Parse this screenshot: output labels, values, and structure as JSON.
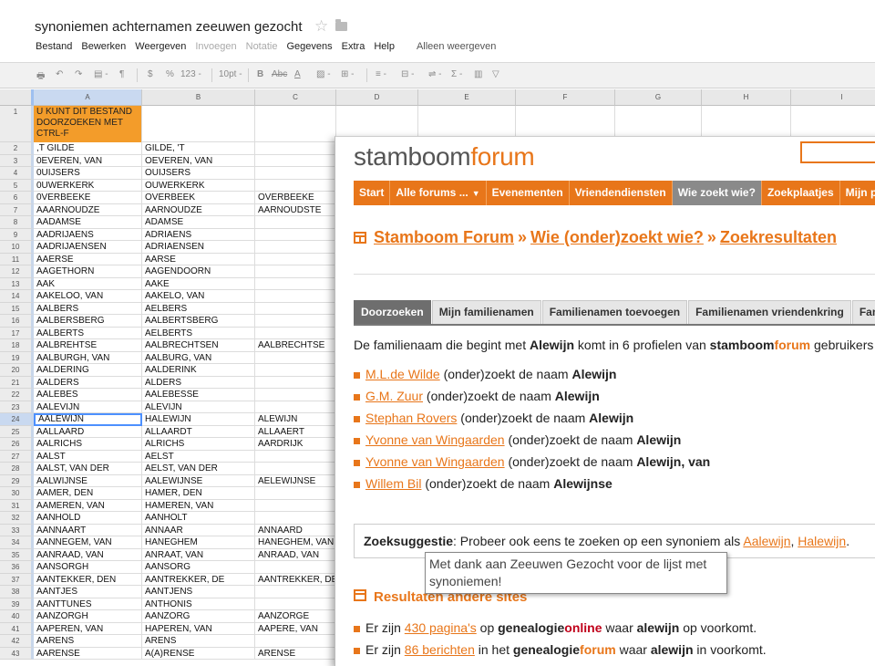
{
  "doc": {
    "title": "synoniemen achternamen zeeuwen gezocht"
  },
  "menu": [
    "Bestand",
    "Bewerken",
    "Weergeven",
    "Invoegen",
    "Notatie",
    "Gegevens",
    "Extra",
    "Help"
  ],
  "menu_disabled": [
    "Invoegen",
    "Notatie"
  ],
  "view_only": "Alleen weergeven",
  "toolbar": {
    "currency": "$",
    "percent": "%",
    "number_format": "123 -",
    "font_size": "10pt -",
    "bold": "B",
    "abc": "Abc",
    "text_color": "A",
    "sum": "Σ -"
  },
  "columns": [
    "A",
    "B",
    "C",
    "D",
    "E",
    "F",
    "G",
    "H",
    "I"
  ],
  "header_row": {
    "num": "1",
    "text": "U KUNT DIT BESTAND DOORZOEKEN MET CTRL-F"
  },
  "rows": [
    {
      "n": "2",
      "a": ",T GILDE",
      "b": "GILDE, 'T",
      "c": ""
    },
    {
      "n": "3",
      "a": "0EVEREN, VAN",
      "b": "OEVEREN, VAN",
      "c": ""
    },
    {
      "n": "4",
      "a": "0UIJSERS",
      "b": "OUIJSERS",
      "c": ""
    },
    {
      "n": "5",
      "a": "0UWERKERK",
      "b": "OUWERKERK",
      "c": ""
    },
    {
      "n": "6",
      "a": "0VERBEEKE",
      "b": "OVERBEEK",
      "c": "OVERBEEKE"
    },
    {
      "n": "7",
      "a": "AAARNOUDZE",
      "b": "AARNOUDZE",
      "c": "AARNOUDSTE"
    },
    {
      "n": "8",
      "a": "AADAMSE",
      "b": "ADAMSE",
      "c": ""
    },
    {
      "n": "9",
      "a": "AADRIJAENS",
      "b": "ADRIAENS",
      "c": ""
    },
    {
      "n": "10",
      "a": "AADRIJAENSEN",
      "b": "ADRIAENSEN",
      "c": ""
    },
    {
      "n": "11",
      "a": "AAERSE",
      "b": "AARSE",
      "c": ""
    },
    {
      "n": "12",
      "a": "AAGETHORN",
      "b": "AAGENDOORN",
      "c": ""
    },
    {
      "n": "13",
      "a": "AAK",
      "b": "AAKE",
      "c": ""
    },
    {
      "n": "14",
      "a": "AAKELOO, VAN",
      "b": "AAKELO, VAN",
      "c": ""
    },
    {
      "n": "15",
      "a": "AALBERS",
      "b": "AELBERS",
      "c": ""
    },
    {
      "n": "16",
      "a": "AALBERSBERG",
      "b": "AALBERTSBERG",
      "c": ""
    },
    {
      "n": "17",
      "a": "AALBERTS",
      "b": "AELBERTS",
      "c": ""
    },
    {
      "n": "18",
      "a": "AALBREHTSE",
      "b": "AALBRECHTSEN",
      "c": "AALBRECHTSE"
    },
    {
      "n": "19",
      "a": "AALBURGH, VAN",
      "b": "AALBURG, VAN",
      "c": ""
    },
    {
      "n": "20",
      "a": "AALDERING",
      "b": "AALDERINK",
      "c": ""
    },
    {
      "n": "21",
      "a": "AALDERS",
      "b": "ALDERS",
      "c": ""
    },
    {
      "n": "22",
      "a": "AALEBES",
      "b": "AALEBESSE",
      "c": ""
    },
    {
      "n": "23",
      "a": "AALEVIJN",
      "b": "ALEVIJN",
      "c": ""
    },
    {
      "n": "24",
      "a": "AALEWIJN",
      "b": "HALEWIJN",
      "c": "ALEWIJN"
    },
    {
      "n": "25",
      "a": "AALLAARD",
      "b": "ALLAARDT",
      "c": "ALLAAERT"
    },
    {
      "n": "26",
      "a": "AALRICHS",
      "b": "ALRICHS",
      "c": "AARDRIJK"
    },
    {
      "n": "27",
      "a": "AALST",
      "b": "AELST",
      "c": ""
    },
    {
      "n": "28",
      "a": "AALST, VAN DER",
      "b": "AELST, VAN DER",
      "c": ""
    },
    {
      "n": "29",
      "a": "AALWIJNSE",
      "b": "AALEWIJNSE",
      "c": "AELEWIJNSE"
    },
    {
      "n": "30",
      "a": "AAMER, DEN",
      "b": "HAMER, DEN",
      "c": ""
    },
    {
      "n": "31",
      "a": "AAMEREN, VAN",
      "b": "HAMEREN, VAN",
      "c": ""
    },
    {
      "n": "32",
      "a": "AANHOLD",
      "b": "AANHOLT",
      "c": ""
    },
    {
      "n": "33",
      "a": "AANNAART",
      "b": "ANNAAR",
      "c": "ANNAARD"
    },
    {
      "n": "34",
      "a": "AANNEGEM, VAN",
      "b": "HANEGHEM",
      "c": "HANEGHEM, VAN"
    },
    {
      "n": "35",
      "a": "AANRAAD, VAN",
      "b": "ANRAAT, VAN",
      "c": "ANRAAD, VAN"
    },
    {
      "n": "36",
      "a": "AANSORGH",
      "b": "AANSORG",
      "c": ""
    },
    {
      "n": "37",
      "a": "AANTEKKER, DEN",
      "b": "AANTREKKER, DE",
      "c": "AANTREKKER, DE"
    },
    {
      "n": "38",
      "a": "AANTJES",
      "b": "AANTJENS",
      "c": ""
    },
    {
      "n": "39",
      "a": "AANTTUNES",
      "b": "ANTHONIS",
      "c": ""
    },
    {
      "n": "40",
      "a": "AANZORGH",
      "b": "AANZORG",
      "c": "AANZORGE"
    },
    {
      "n": "41",
      "a": "AAPEREN, VAN",
      "b": "HAPEREN, VAN",
      "c": "AAPERE, VAN"
    },
    {
      "n": "42",
      "a": "AARENS",
      "b": "ARENS",
      "c": ""
    },
    {
      "n": "43",
      "a": "AARENSE",
      "b": "A(A)RENSE",
      "c": "ARENSE"
    }
  ],
  "selected_row": "24",
  "forum": {
    "logo_plain": "stamboom",
    "logo_accent": "forum",
    "nav": [
      {
        "label": "Start"
      },
      {
        "label": "Alle forums ...",
        "caret": "▼"
      },
      {
        "label": "Evenementen"
      },
      {
        "label": "Vriendendiensten"
      },
      {
        "label": "Wie zoekt wie?",
        "active": true
      },
      {
        "label": "Zoekplaatjes"
      },
      {
        "label": "Mijn p"
      }
    ],
    "breadcrumb": [
      "Stamboom Forum",
      "Wie (onder)zoekt wie?",
      "Zoekresultaten"
    ],
    "breadcrumb_sep": "»",
    "tabs": [
      {
        "label": "Doorzoeken",
        "active": true
      },
      {
        "label": "Mijn familienamen"
      },
      {
        "label": "Familienamen toevoegen"
      },
      {
        "label": "Familienamen vriendenkring"
      },
      {
        "label": "Familien"
      }
    ],
    "intro": {
      "p1": "De familienaam die begint met ",
      "name": "Alewijn",
      "p2": " komt in 6 profielen van ",
      "site_plain": "stamboom",
      "site_accent": "forum",
      "p3": " gebruikers"
    },
    "results": [
      {
        "user": "M.L.de Wilde",
        "text": " (onder)zoekt de naam ",
        "name": "Alewijn"
      },
      {
        "user": "G.M. Zuur",
        "text": " (onder)zoekt de naam ",
        "name": "Alewijn"
      },
      {
        "user": "Stephan Rovers",
        "text": " (onder)zoekt de naam ",
        "name": "Alewijn"
      },
      {
        "user": "Yvonne van Wingaarden",
        "text": " (onder)zoekt de naam ",
        "name": "Alewijn"
      },
      {
        "user": "Yvonne van Wingaarden",
        "text": " (onder)zoekt de naam ",
        "name": "Alewijn, van"
      },
      {
        "user": "Willem Bil",
        "text": " (onder)zoekt de naam ",
        "name": "Alewijnse"
      }
    ],
    "suggestion": {
      "label": "Zoeksuggestie",
      "text": ": Probeer ook eens te zoeken op een synoniem als ",
      "link1": "Aalewijn",
      "comma": ", ",
      "link2": "Halewijn",
      "end": "."
    },
    "tooltip": "Met dank aan Zeeuwen Gezocht voor de lijst met synoniemen!",
    "other_title": "Resultaten andere sites",
    "other": [
      {
        "pre": "Er zijn ",
        "link": "430 pagina's",
        "mid": " op ",
        "site_a": "genealogie",
        "site_b": "online",
        "site_b_style": "online",
        "post1": " waar ",
        "word": "alewijn",
        "post2": " op voorkomt."
      },
      {
        "pre": "Er zijn ",
        "link": "86 berichten",
        "mid": " in het ",
        "site_a": "genealogie",
        "site_b": "forum",
        "site_b_style": "acc",
        "post1": " waar ",
        "word": "alewijn",
        "post2": " in voorkomt."
      }
    ]
  },
  "colors": {
    "accent": "#e8761a",
    "header_cell": "#f39c2a",
    "selection": "#4d90fe",
    "active_nav": "#8a8a8a"
  }
}
